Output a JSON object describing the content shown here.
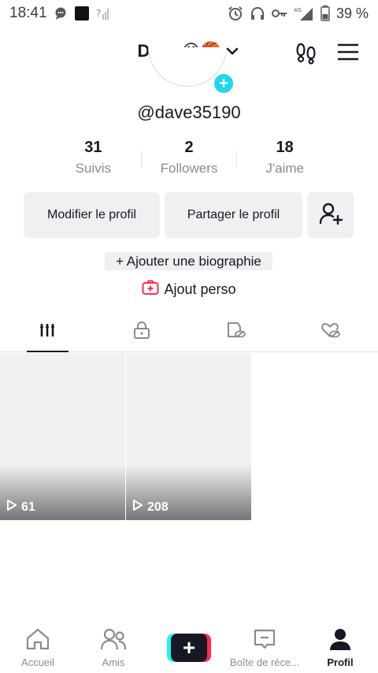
{
  "status_bar": {
    "time": "18:41",
    "battery": "39 %",
    "network": "4G"
  },
  "header": {
    "name": "Dave",
    "emoji": "😊🏀"
  },
  "profile": {
    "username": "@dave35190"
  },
  "stats": [
    {
      "value": "31",
      "label": "Suivis"
    },
    {
      "value": "2",
      "label": "Followers"
    },
    {
      "value": "18",
      "label": "J'aime"
    }
  ],
  "actions": {
    "edit": "Modifier le profil",
    "share": "Partager le profil"
  },
  "bio": {
    "add": "+ Ajouter une biographie"
  },
  "perso": {
    "label": "Ajout perso"
  },
  "videos": [
    {
      "views": "61"
    },
    {
      "views": "208"
    }
  ],
  "nav": {
    "home": "Accueil",
    "friends": "Amis",
    "inbox": "Boîte de réce...",
    "profile": "Profil"
  },
  "colors": {
    "accent_pink": "#fe2c55",
    "accent_cyan": "#25f4ee",
    "text": "#161823",
    "muted": "#8a8b91"
  }
}
